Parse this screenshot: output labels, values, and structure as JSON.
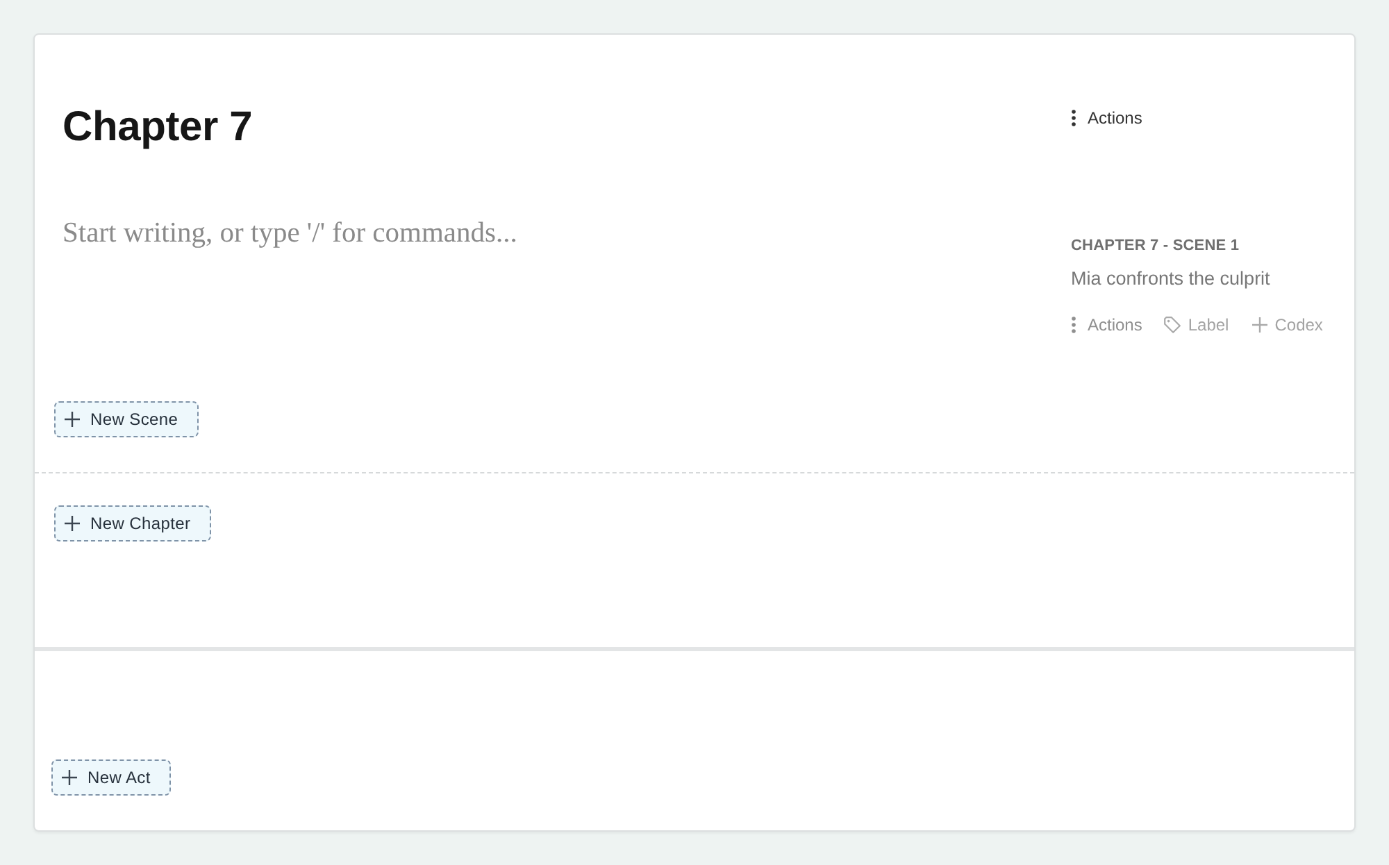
{
  "chapter": {
    "title": "Chapter 7",
    "actions_button": "Actions",
    "editor": {
      "placeholder": "Start writing, or type '/' for commands..."
    },
    "scene": {
      "heading": "CHAPTER 7 - SCENE 1",
      "summary": "Mia confronts the culprit",
      "actions": [
        {
          "kind": "menu",
          "label": "Actions"
        },
        {
          "kind": "tag",
          "label": "Label"
        },
        {
          "kind": "add",
          "label": "Codex"
        }
      ]
    },
    "new_scene_button": "New Scene",
    "new_chapter_button": "New Chapter"
  },
  "act": {
    "new_act_button": "New Act"
  }
}
